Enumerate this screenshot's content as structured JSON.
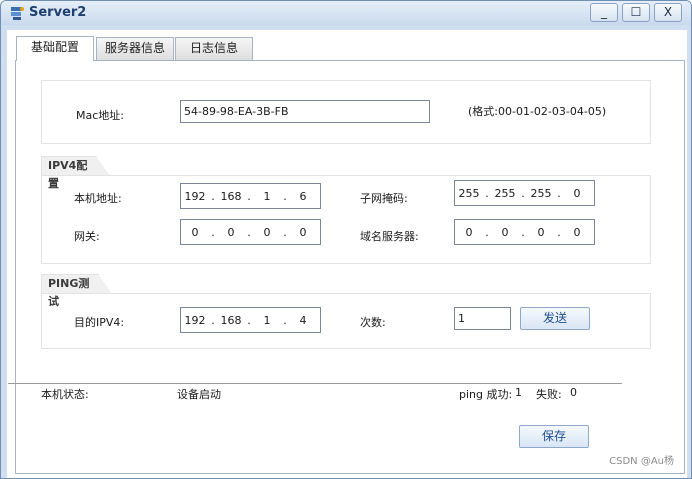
{
  "window": {
    "title": "Server2",
    "minimize_label": "_",
    "maximize_label": "☐",
    "close_label": "X"
  },
  "tabs": [
    {
      "label": "基础配置"
    },
    {
      "label": "服务器信息"
    },
    {
      "label": "日志信息"
    }
  ],
  "mac": {
    "label": "Mac地址:",
    "value": "54-89-98-EA-3B-FB",
    "format_hint": "(格式:00-01-02-03-04-05)"
  },
  "ipv4": {
    "group_label": "IPV4配置",
    "host_ip_label": "本机地址:",
    "host_ip": [
      "192",
      "168",
      "1",
      "6"
    ],
    "subnet_label": "子网掩码:",
    "subnet": [
      "255",
      "255",
      "255",
      "0"
    ],
    "gateway_label": "网关:",
    "gateway": [
      "0",
      "0",
      "0",
      "0"
    ],
    "dns_label": "域名服务器:",
    "dns": [
      "0",
      "0",
      "0",
      "0"
    ]
  },
  "ping": {
    "group_label": "PING测试",
    "target_label": "目的IPV4:",
    "target": [
      "192",
      "168",
      "1",
      "4"
    ],
    "count_label": "次数:",
    "count_value": "1",
    "send_label": "发送"
  },
  "status": {
    "label": "本机状态:",
    "value": "设备启动",
    "ping_success_label": "ping 成功:",
    "ping_success_value": "1",
    "ping_fail_label": "失败:",
    "ping_fail_value": "0"
  },
  "save_label": "保存",
  "watermark": "CSDN @Au杨",
  "colors": {
    "titlebar": "#c9daee",
    "button_text": "#1f4e8c",
    "border": "#a9b4c2"
  }
}
